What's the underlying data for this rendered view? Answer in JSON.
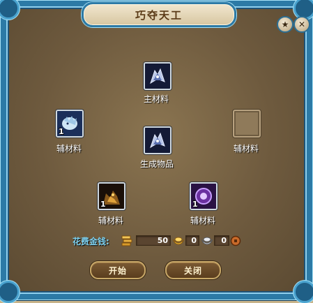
{
  "window": {
    "title": "巧夺天工",
    "buttons": {
      "star_icon": "star-icon",
      "close_icon": "close-icon"
    }
  },
  "slots": {
    "main_material": {
      "label": "主材料",
      "icon": "armor-icon"
    },
    "aux_left": {
      "label": "辅材料",
      "icon": "crystal-beast-icon",
      "qty": "1"
    },
    "aux_right": {
      "label": "辅材料",
      "icon": "empty"
    },
    "result": {
      "label": "生成物品",
      "icon": "armor-icon"
    },
    "aux_bottom_left": {
      "label": "辅材料",
      "icon": "golden-beast-icon",
      "qty": "1"
    },
    "aux_bottom_right": {
      "label": "辅材料",
      "icon": "purple-orb-icon",
      "qty": "1"
    }
  },
  "cost": {
    "label": "花费金钱:",
    "gold": "50",
    "silver": "0",
    "copper": "0",
    "icons": [
      "coin-stack-icon",
      "gold-ingot-icon",
      "silver-ingot-icon",
      "copper-coin-icon"
    ]
  },
  "actions": {
    "start_label": "开始",
    "close_label": "关闭"
  },
  "colors": {
    "frame": "#2c7aa6",
    "panel": "#6e5a3e",
    "cost_label": "#7fd3f2",
    "button_border": "#c8a868"
  }
}
